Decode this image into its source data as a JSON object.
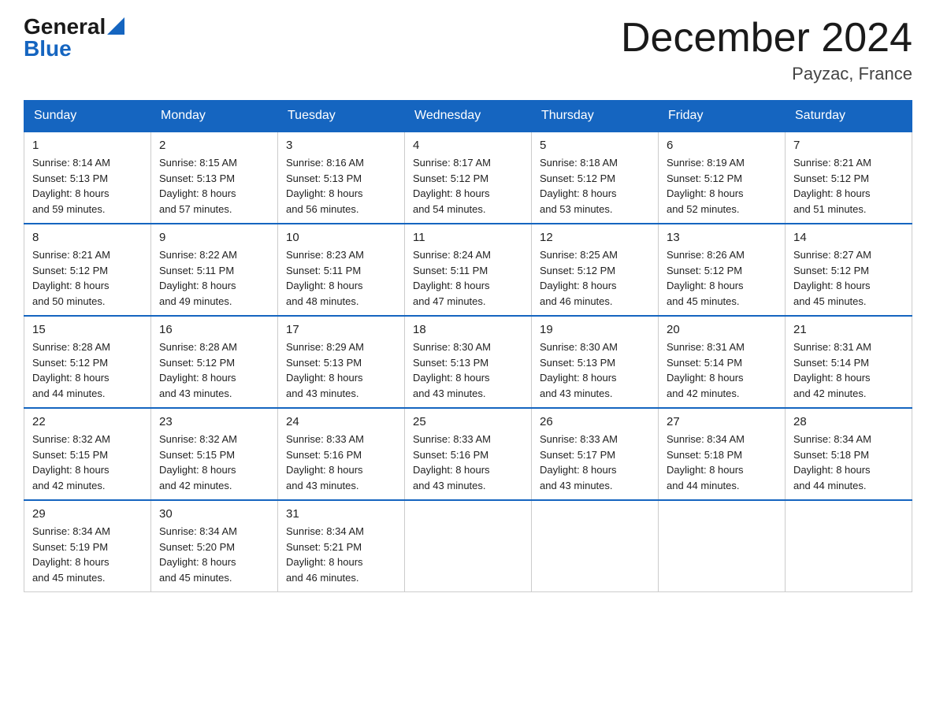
{
  "header": {
    "logo_general": "General",
    "logo_blue": "Blue",
    "month_title": "December 2024",
    "location": "Payzac, France"
  },
  "calendar": {
    "days_of_week": [
      "Sunday",
      "Monday",
      "Tuesday",
      "Wednesday",
      "Thursday",
      "Friday",
      "Saturday"
    ],
    "weeks": [
      [
        {
          "day": "1",
          "sunrise": "8:14 AM",
          "sunset": "5:13 PM",
          "daylight": "8 hours and 59 minutes."
        },
        {
          "day": "2",
          "sunrise": "8:15 AM",
          "sunset": "5:13 PM",
          "daylight": "8 hours and 57 minutes."
        },
        {
          "day": "3",
          "sunrise": "8:16 AM",
          "sunset": "5:13 PM",
          "daylight": "8 hours and 56 minutes."
        },
        {
          "day": "4",
          "sunrise": "8:17 AM",
          "sunset": "5:12 PM",
          "daylight": "8 hours and 54 minutes."
        },
        {
          "day": "5",
          "sunrise": "8:18 AM",
          "sunset": "5:12 PM",
          "daylight": "8 hours and 53 minutes."
        },
        {
          "day": "6",
          "sunrise": "8:19 AM",
          "sunset": "5:12 PM",
          "daylight": "8 hours and 52 minutes."
        },
        {
          "day": "7",
          "sunrise": "8:21 AM",
          "sunset": "5:12 PM",
          "daylight": "8 hours and 51 minutes."
        }
      ],
      [
        {
          "day": "8",
          "sunrise": "8:21 AM",
          "sunset": "5:12 PM",
          "daylight": "8 hours and 50 minutes."
        },
        {
          "day": "9",
          "sunrise": "8:22 AM",
          "sunset": "5:11 PM",
          "daylight": "8 hours and 49 minutes."
        },
        {
          "day": "10",
          "sunrise": "8:23 AM",
          "sunset": "5:11 PM",
          "daylight": "8 hours and 48 minutes."
        },
        {
          "day": "11",
          "sunrise": "8:24 AM",
          "sunset": "5:11 PM",
          "daylight": "8 hours and 47 minutes."
        },
        {
          "day": "12",
          "sunrise": "8:25 AM",
          "sunset": "5:12 PM",
          "daylight": "8 hours and 46 minutes."
        },
        {
          "day": "13",
          "sunrise": "8:26 AM",
          "sunset": "5:12 PM",
          "daylight": "8 hours and 45 minutes."
        },
        {
          "day": "14",
          "sunrise": "8:27 AM",
          "sunset": "5:12 PM",
          "daylight": "8 hours and 45 minutes."
        }
      ],
      [
        {
          "day": "15",
          "sunrise": "8:28 AM",
          "sunset": "5:12 PM",
          "daylight": "8 hours and 44 minutes."
        },
        {
          "day": "16",
          "sunrise": "8:28 AM",
          "sunset": "5:12 PM",
          "daylight": "8 hours and 43 minutes."
        },
        {
          "day": "17",
          "sunrise": "8:29 AM",
          "sunset": "5:13 PM",
          "daylight": "8 hours and 43 minutes."
        },
        {
          "day": "18",
          "sunrise": "8:30 AM",
          "sunset": "5:13 PM",
          "daylight": "8 hours and 43 minutes."
        },
        {
          "day": "19",
          "sunrise": "8:30 AM",
          "sunset": "5:13 PM",
          "daylight": "8 hours and 43 minutes."
        },
        {
          "day": "20",
          "sunrise": "8:31 AM",
          "sunset": "5:14 PM",
          "daylight": "8 hours and 42 minutes."
        },
        {
          "day": "21",
          "sunrise": "8:31 AM",
          "sunset": "5:14 PM",
          "daylight": "8 hours and 42 minutes."
        }
      ],
      [
        {
          "day": "22",
          "sunrise": "8:32 AM",
          "sunset": "5:15 PM",
          "daylight": "8 hours and 42 minutes."
        },
        {
          "day": "23",
          "sunrise": "8:32 AM",
          "sunset": "5:15 PM",
          "daylight": "8 hours and 42 minutes."
        },
        {
          "day": "24",
          "sunrise": "8:33 AM",
          "sunset": "5:16 PM",
          "daylight": "8 hours and 43 minutes."
        },
        {
          "day": "25",
          "sunrise": "8:33 AM",
          "sunset": "5:16 PM",
          "daylight": "8 hours and 43 minutes."
        },
        {
          "day": "26",
          "sunrise": "8:33 AM",
          "sunset": "5:17 PM",
          "daylight": "8 hours and 43 minutes."
        },
        {
          "day": "27",
          "sunrise": "8:34 AM",
          "sunset": "5:18 PM",
          "daylight": "8 hours and 44 minutes."
        },
        {
          "day": "28",
          "sunrise": "8:34 AM",
          "sunset": "5:18 PM",
          "daylight": "8 hours and 44 minutes."
        }
      ],
      [
        {
          "day": "29",
          "sunrise": "8:34 AM",
          "sunset": "5:19 PM",
          "daylight": "8 hours and 45 minutes."
        },
        {
          "day": "30",
          "sunrise": "8:34 AM",
          "sunset": "5:20 PM",
          "daylight": "8 hours and 45 minutes."
        },
        {
          "day": "31",
          "sunrise": "8:34 AM",
          "sunset": "5:21 PM",
          "daylight": "8 hours and 46 minutes."
        },
        null,
        null,
        null,
        null
      ]
    ]
  }
}
